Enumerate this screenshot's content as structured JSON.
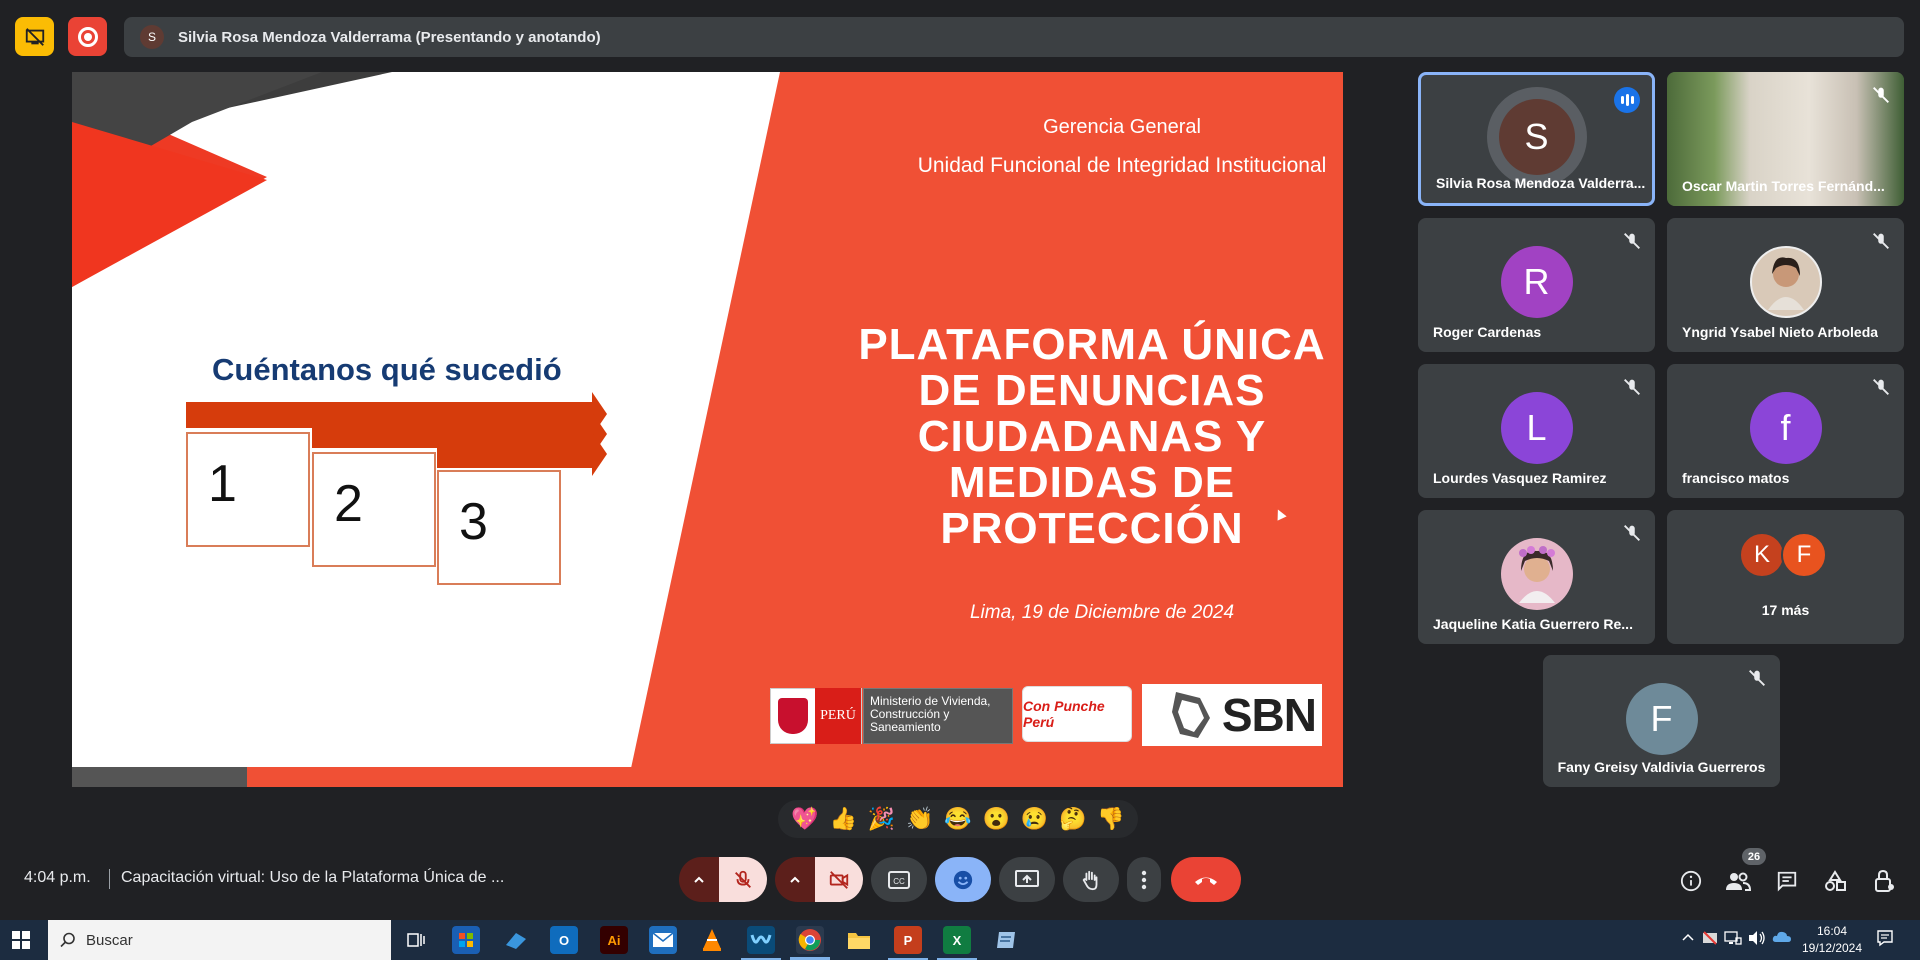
{
  "presenter": {
    "avatar_letter": "S",
    "banner_text": "Silvia Rosa Mendoza Valderrama (Presentando y anotando)"
  },
  "slide": {
    "org_line1": "Gerencia General",
    "org_line2": "Unidad Funcional de Integridad Institucional",
    "title_lines": [
      "PLATAFORMA ÚNICA",
      "DE DENUNCIAS",
      "CIUDADANAS Y",
      "MEDIDAS DE",
      "PROTECCIÓN"
    ],
    "date": "Lima,  19 de Diciembre de 2024",
    "left_heading": "Cuéntanos qué sucedió",
    "steps": [
      "1",
      "2",
      "3"
    ],
    "logos": {
      "peru": "PERÚ",
      "ministerio": "Ministerio de Vivienda, Construcción y Saneamiento",
      "punche": "Con Punche Perú",
      "sbn": "SBN"
    }
  },
  "participants": [
    {
      "name": "Silvia Rosa Mendoza Valderra...",
      "letter": "S",
      "color": "#5f3b33",
      "state": "speaking"
    },
    {
      "name": "Oscar Martin Torres Fernánd...",
      "letter": "",
      "color": "",
      "state": "muted"
    },
    {
      "name": "Roger Cardenas",
      "letter": "R",
      "color": "#a142c3",
      "state": "muted"
    },
    {
      "name": "Yngrid Ysabel Nieto Arboleda",
      "letter": "",
      "color": "#d9c9b8",
      "state": "muted"
    },
    {
      "name": "Lourdes Vasquez Ramirez",
      "letter": "L",
      "color": "#8b45d8",
      "state": "muted"
    },
    {
      "name": "francisco matos",
      "letter": "f",
      "color": "#8b45d8",
      "state": "muted"
    },
    {
      "name": "Jaqueline Katia Guerrero Re...",
      "letter": "",
      "color": "#e6b8c8",
      "state": "muted"
    },
    {
      "name": "Fany Greisy Valdivia Guerreros",
      "letter": "F",
      "color": "#6e8a99",
      "state": "muted"
    }
  ],
  "more": {
    "avatars": [
      {
        "letter": "K",
        "color": "#c5411e"
      },
      {
        "letter": "F",
        "color": "#e8531f"
      }
    ],
    "label": "17 más"
  },
  "reactions": [
    "💖",
    "👍",
    "🎉",
    "👏",
    "😂",
    "😮",
    "😢",
    "🤔",
    "👎"
  ],
  "meeting": {
    "time": "4:04 p.m.",
    "title": "Capacitación virtual: Uso de la Plataforma Única de ...",
    "people_count": "26"
  },
  "taskbar": {
    "search_placeholder": "Buscar",
    "clock_time": "16:04",
    "clock_date": "19/12/2024"
  }
}
